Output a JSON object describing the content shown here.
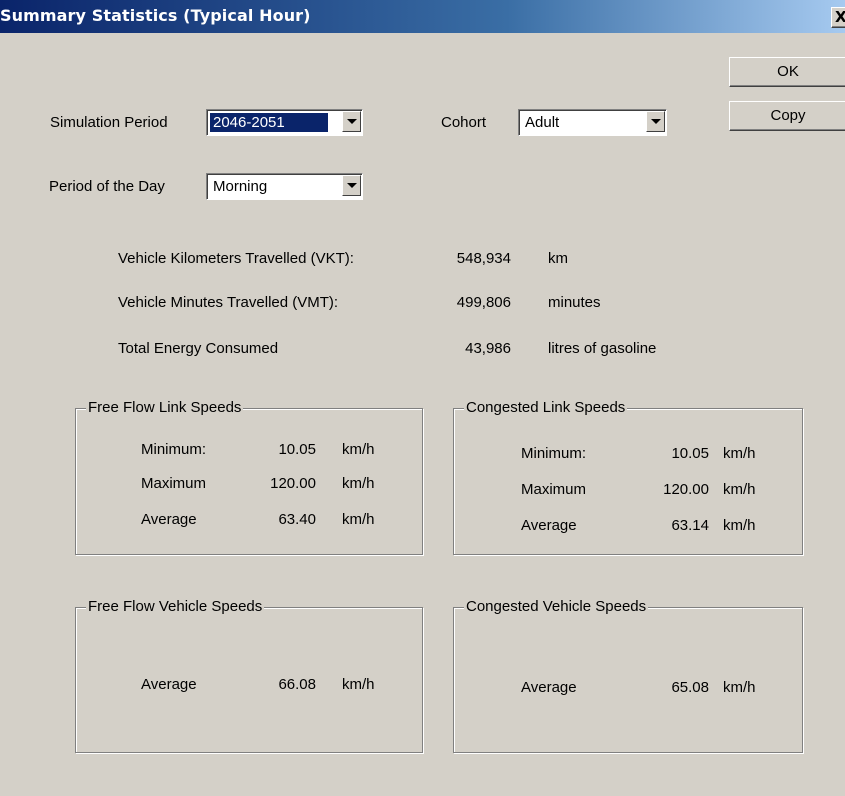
{
  "window": {
    "title": "Summary Statistics (Typical Hour)",
    "close_glyph": "X"
  },
  "buttons": {
    "ok_label": "OK",
    "copy_label": "Copy"
  },
  "simulation_period": {
    "label": "Simulation Period",
    "value": "2046-2051"
  },
  "cohort": {
    "label": "Cohort",
    "value": "Adult"
  },
  "period_of_day": {
    "label": "Period of the Day",
    "value": "Morning"
  },
  "totals": [
    {
      "label": "Vehicle Kilometers Travelled (VKT):",
      "value": "548,934",
      "unit": "km"
    },
    {
      "label": "Vehicle Minutes Travelled (VMT):",
      "value": "499,806",
      "unit": "minutes"
    },
    {
      "label": "Total Energy Consumed",
      "value": "43,986",
      "unit": "litres of gasoline"
    }
  ],
  "free_flow_link": {
    "title": "Free Flow Link Speeds",
    "rows": [
      {
        "label": "Minimum:",
        "value": "10.05",
        "unit": "km/h"
      },
      {
        "label": "Maximum",
        "value": "120.00",
        "unit": "km/h"
      },
      {
        "label": "Average",
        "value": "63.40",
        "unit": "km/h"
      }
    ]
  },
  "congested_link": {
    "title": "Congested Link Speeds",
    "rows": [
      {
        "label": "Minimum:",
        "value": "10.05",
        "unit": "km/h"
      },
      {
        "label": "Maximum",
        "value": "120.00",
        "unit": "km/h"
      },
      {
        "label": "Average",
        "value": "63.14",
        "unit": "km/h"
      }
    ]
  },
  "free_flow_vehicle": {
    "title": "Free Flow Vehicle Speeds",
    "rows": [
      {
        "label": "Average",
        "value": "66.08",
        "unit": "km/h"
      }
    ]
  },
  "congested_vehicle": {
    "title": "Congested Vehicle Speeds",
    "rows": [
      {
        "label": "Average",
        "value": "65.08",
        "unit": "km/h"
      }
    ]
  }
}
